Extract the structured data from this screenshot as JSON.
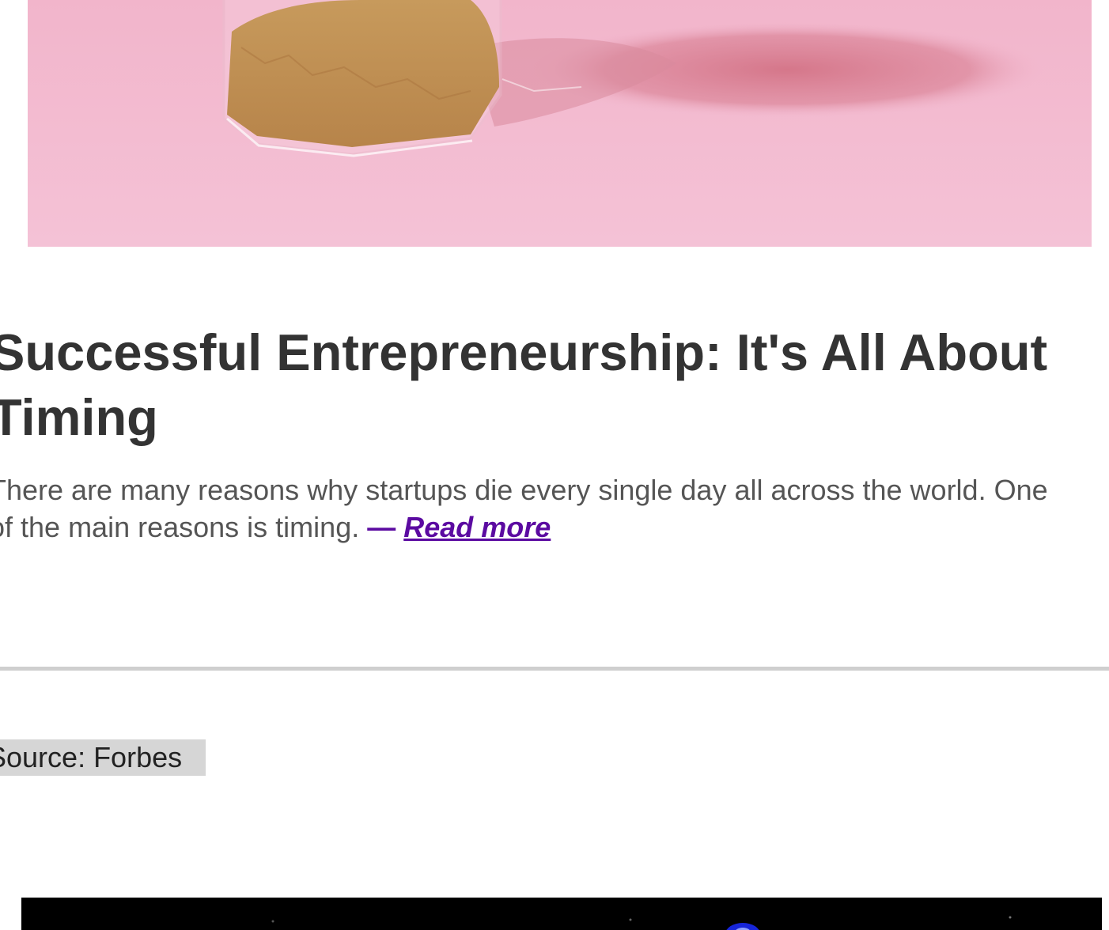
{
  "article": {
    "image_description_icon": "hourglass-sand-jar-image",
    "title": "Successful Entrepreneurship: It's All About Timing",
    "excerpt_line1": "There are many reasons why startups die every single day all across the world. One",
    "excerpt_line2_prefix": "of the main reasons is timing. ",
    "dash": "—",
    "read_more_label": "Read more"
  },
  "source": {
    "label": "Source: Forbes"
  },
  "colors": {
    "link": "#5b0aa1",
    "hero_background": "#f3b6cc",
    "divider": "#cfcfcf",
    "source_tag": "#d6d6d6"
  }
}
